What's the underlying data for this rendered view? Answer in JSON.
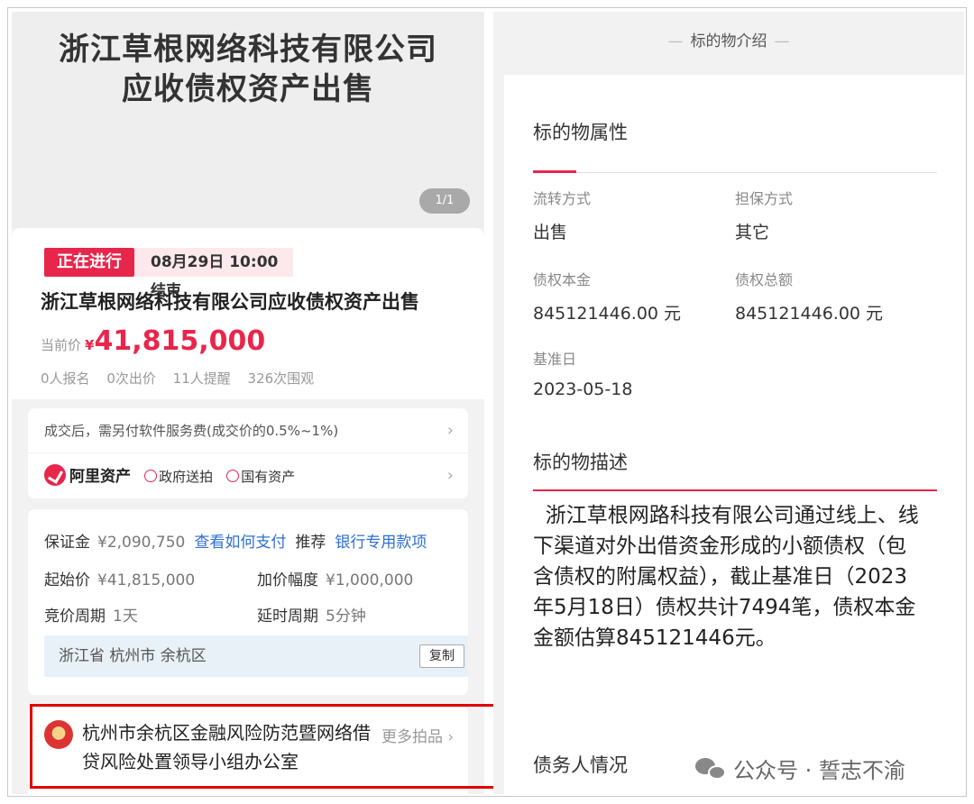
{
  "left": {
    "hero": {
      "title_line1": "浙江草根网络科技有限公司",
      "title_line2": "应收债权资产出售",
      "pager": "1/1"
    },
    "auction": {
      "status": "正在进行",
      "end_time": "08月29日 10:00 结束",
      "title": "浙江草根网络科技有限公司应收债权资产出售",
      "price_label": "当前价",
      "currency": "¥",
      "price": "41,815,000",
      "stats": [
        "0人报名",
        "0次出价",
        "11人提醒",
        "326次围观"
      ]
    },
    "fee_notice": "成交后，需另付软件服务费(成交价的0.5%~1%)",
    "platform": {
      "name": "阿里资产",
      "tags": [
        "政府送拍",
        "国有资产"
      ]
    },
    "terms": {
      "deposit_label": "保证金",
      "deposit_value": "¥2,090,750",
      "deposit_link": "查看如何支付",
      "recommend_label": "推荐",
      "recommend_link": "银行专用款项",
      "start_price_label": "起始价",
      "start_price_value": "¥41,815,000",
      "increment_label": "加价幅度",
      "increment_value": "¥1,000,000",
      "cycle_label": "竞价周期",
      "cycle_value": "1天",
      "extend_label": "延时周期",
      "extend_value": "5分钟",
      "address": "浙江省 杭州市 余杭区",
      "copy_label": "复制"
    },
    "organizer": {
      "name": "杭州市余杭区金融风险防范暨网络借贷风险处置领导小组办公室",
      "more": "更多拍品"
    }
  },
  "right": {
    "section_title": "标的物介绍",
    "attributes_heading": "标的物属性",
    "attributes": {
      "transfer_label": "流转方式",
      "transfer_value": "出售",
      "guarantee_label": "担保方式",
      "guarantee_value": "其它",
      "principal_label": "债权本金",
      "principal_value": "845121446.00 元",
      "total_label": "债权总额",
      "total_value": "845121446.00 元",
      "base_date_label": "基准日",
      "base_date_value": "2023-05-18"
    },
    "description_heading": "标的物描述",
    "description": "浙江草根网路科技有限公司通过线上、线下渠道对外出借资金形成的小额债权（包含债权的附属权益），截止基准日（2023年5月18日）债权共计7494笔，债权本金金额估算845121446元。",
    "debtor_heading": "债务人情况",
    "watermark": "公众号 · 誓志不渝"
  },
  "colors": {
    "accent_red": "#e8264c",
    "link_blue": "#2f6fcf",
    "highlight_box": "#e00000"
  }
}
